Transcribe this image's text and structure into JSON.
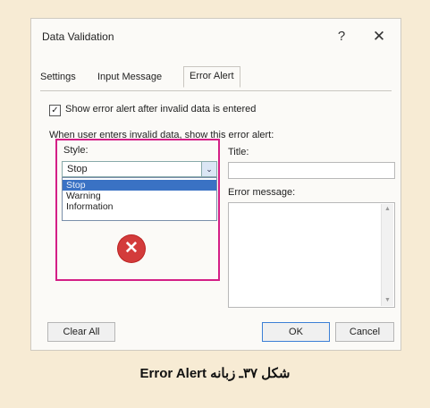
{
  "dialog": {
    "title": "Data Validation",
    "help_glyph": "?",
    "close_glyph": "✕"
  },
  "tabs": [
    {
      "label": "Settings"
    },
    {
      "label": "Input Message"
    },
    {
      "label": "Error Alert",
      "active": true
    }
  ],
  "show_alert": {
    "checked": true,
    "check_glyph": "✓",
    "label": "Show error alert after invalid data is entered"
  },
  "instruction": "When user enters invalid data, show this error alert:",
  "style": {
    "label": "Style:",
    "value": "Stop",
    "dropdown_glyph": "⌄",
    "options": [
      "Stop",
      "Warning",
      "Information"
    ],
    "selected_index": 0
  },
  "error_icon": {
    "glyph": "✕",
    "color": "#d33b3b"
  },
  "title_field": {
    "label": "Title:",
    "value": ""
  },
  "message_field": {
    "label": "Error message:",
    "value": ""
  },
  "buttons": {
    "clear_all": "Clear All",
    "ok": "OK",
    "cancel": "Cancel"
  },
  "caption": "شکل ۳۷ـ زبانه Error Alert",
  "colors": {
    "page_background": "#f7ebd4",
    "highlight_border": "#d41f86",
    "selection": "#3a72c4"
  }
}
